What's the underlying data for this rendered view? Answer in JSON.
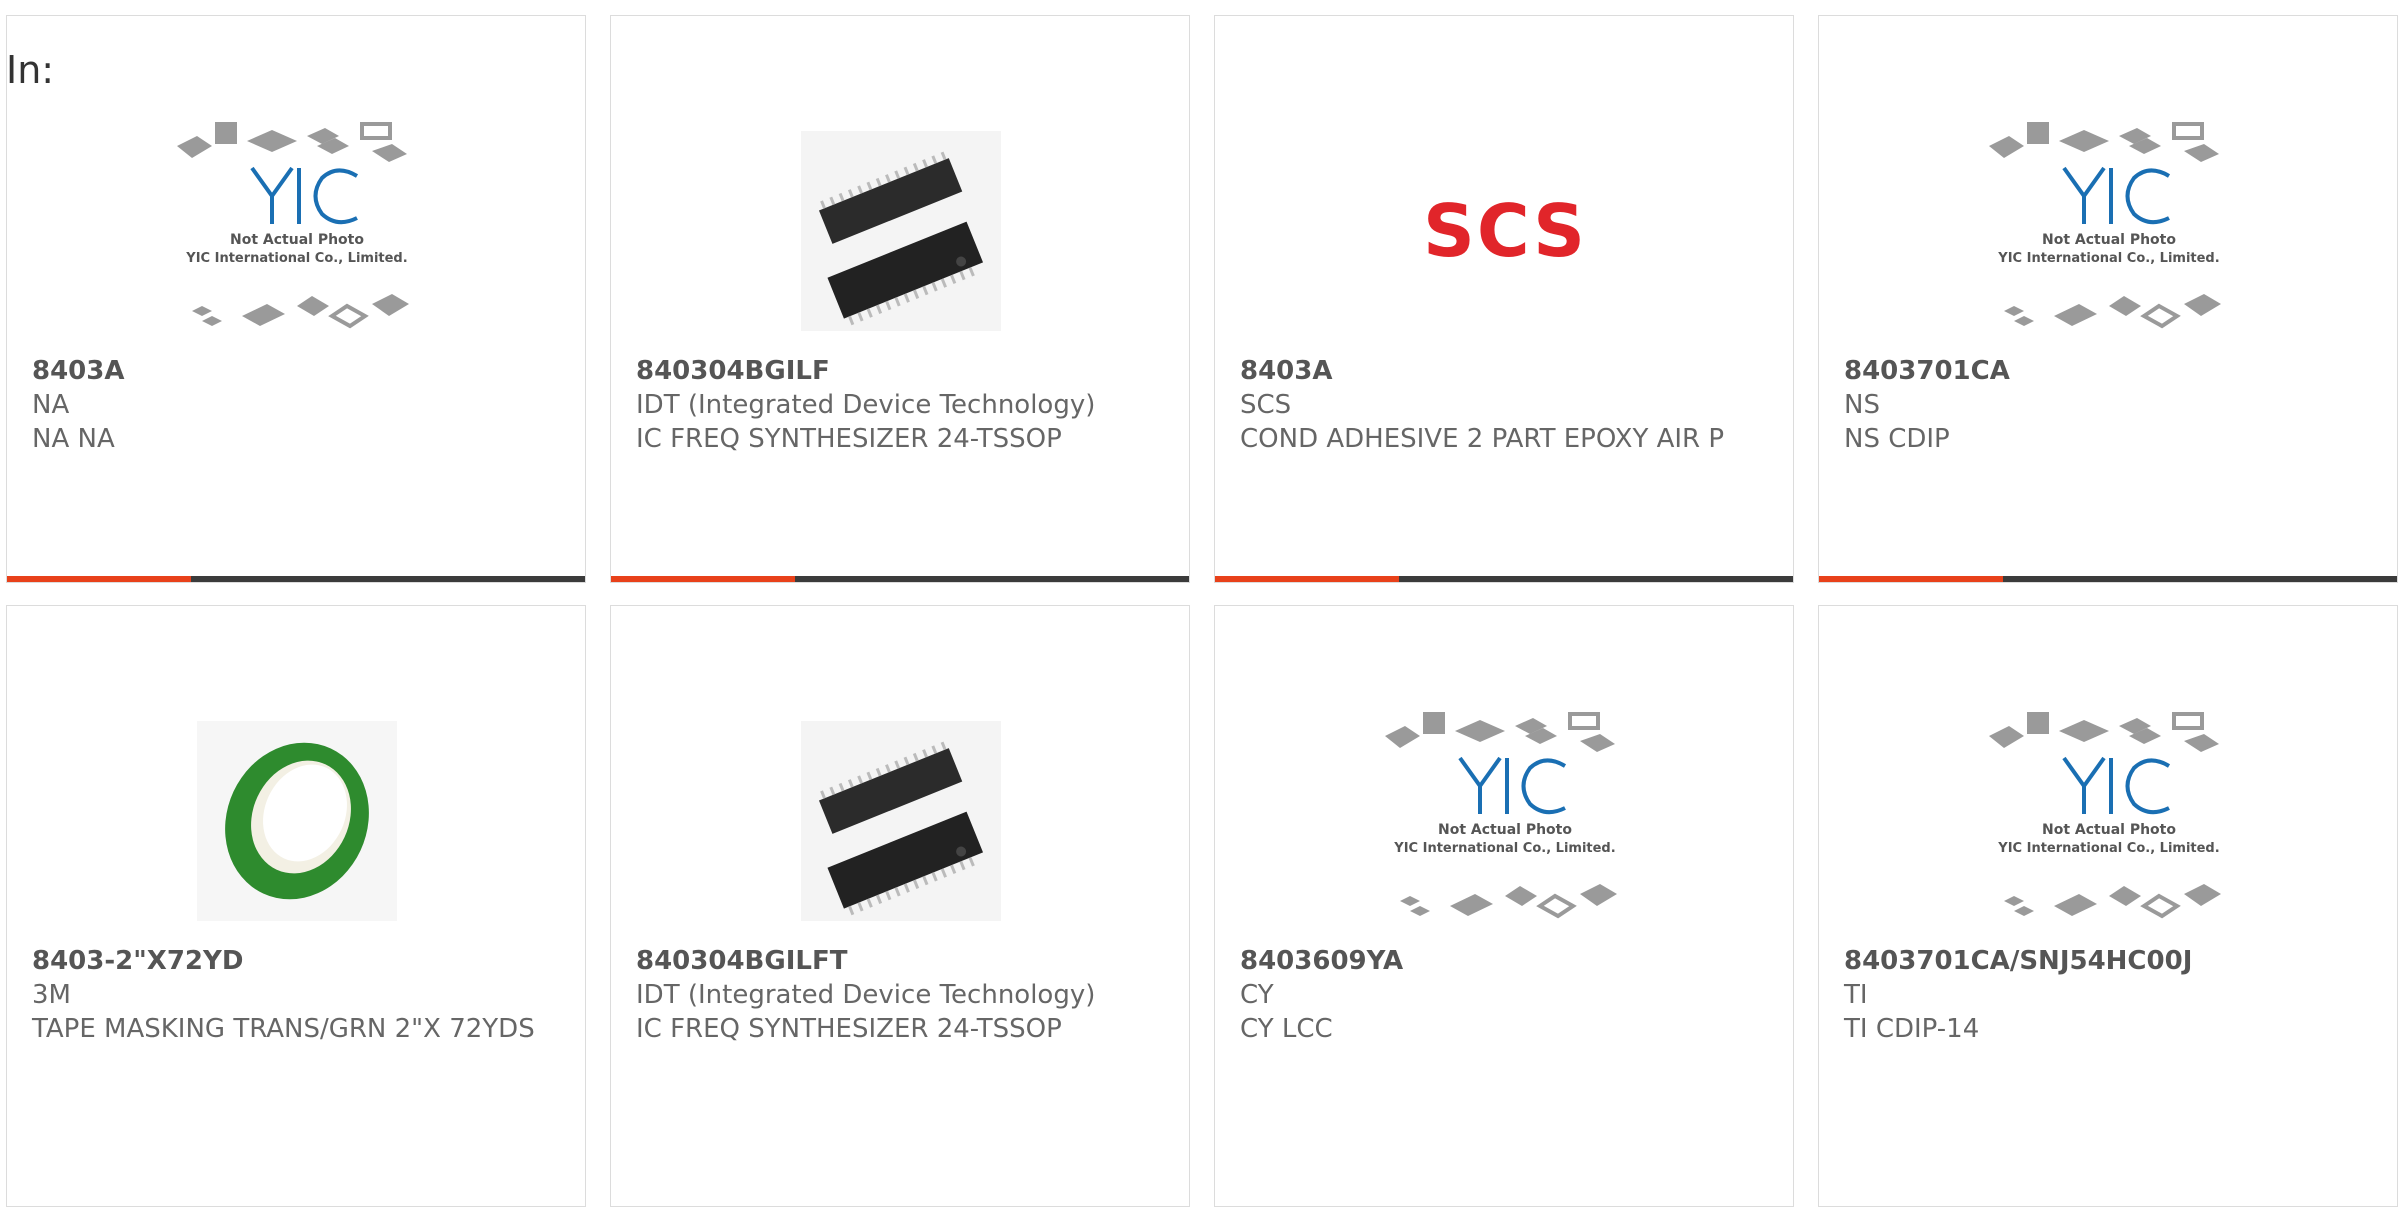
{
  "filter_label": "In:",
  "placeholder": {
    "line1": "Not Actual Photo",
    "line2": "YIC International Co., Limited."
  },
  "colors": {
    "accent": "#e8411a",
    "bar": "#3b3b3b",
    "tape_green": "#2e8b2e",
    "scs_red": "#e1252a"
  },
  "products": [
    {
      "part_number": "8403A",
      "manufacturer": "NA",
      "description": "NA NA",
      "image": "placeholder",
      "image_icon": "yic-placeholder-image"
    },
    {
      "part_number": "840304BGILF",
      "manufacturer": "IDT (Integrated Device Technology)",
      "description": "IC FREQ SYNTHESIZER 24-TSSOP",
      "image": "chip",
      "image_icon": "tssop-chip-image"
    },
    {
      "part_number": "8403A",
      "manufacturer": "SCS",
      "description": "COND ADHESIVE 2 PART EPOXY AIR P",
      "image": "scs",
      "image_icon": "scs-logo",
      "logo_text": "SCS"
    },
    {
      "part_number": "8403701CA",
      "manufacturer": "NS",
      "description": "NS CDIP",
      "image": "placeholder",
      "image_icon": "yic-placeholder-image"
    },
    {
      "part_number": "8403-2\"X72YD",
      "manufacturer": "3M",
      "description": "TAPE MASKING TRANS/GRN 2\"X 72YDS",
      "image": "tape",
      "image_icon": "tape-roll-image"
    },
    {
      "part_number": "840304BGILFT",
      "manufacturer": "IDT (Integrated Device Technology)",
      "description": "IC FREQ SYNTHESIZER 24-TSSOP",
      "image": "chip",
      "image_icon": "tssop-chip-image"
    },
    {
      "part_number": "8403609YA",
      "manufacturer": "CY",
      "description": "CY LCC",
      "image": "placeholder",
      "image_icon": "yic-placeholder-image"
    },
    {
      "part_number": "8403701CA/SNJ54HC00J",
      "manufacturer": "TI",
      "description": "TI CDIP-14",
      "image": "placeholder",
      "image_icon": "yic-placeholder-image"
    }
  ]
}
